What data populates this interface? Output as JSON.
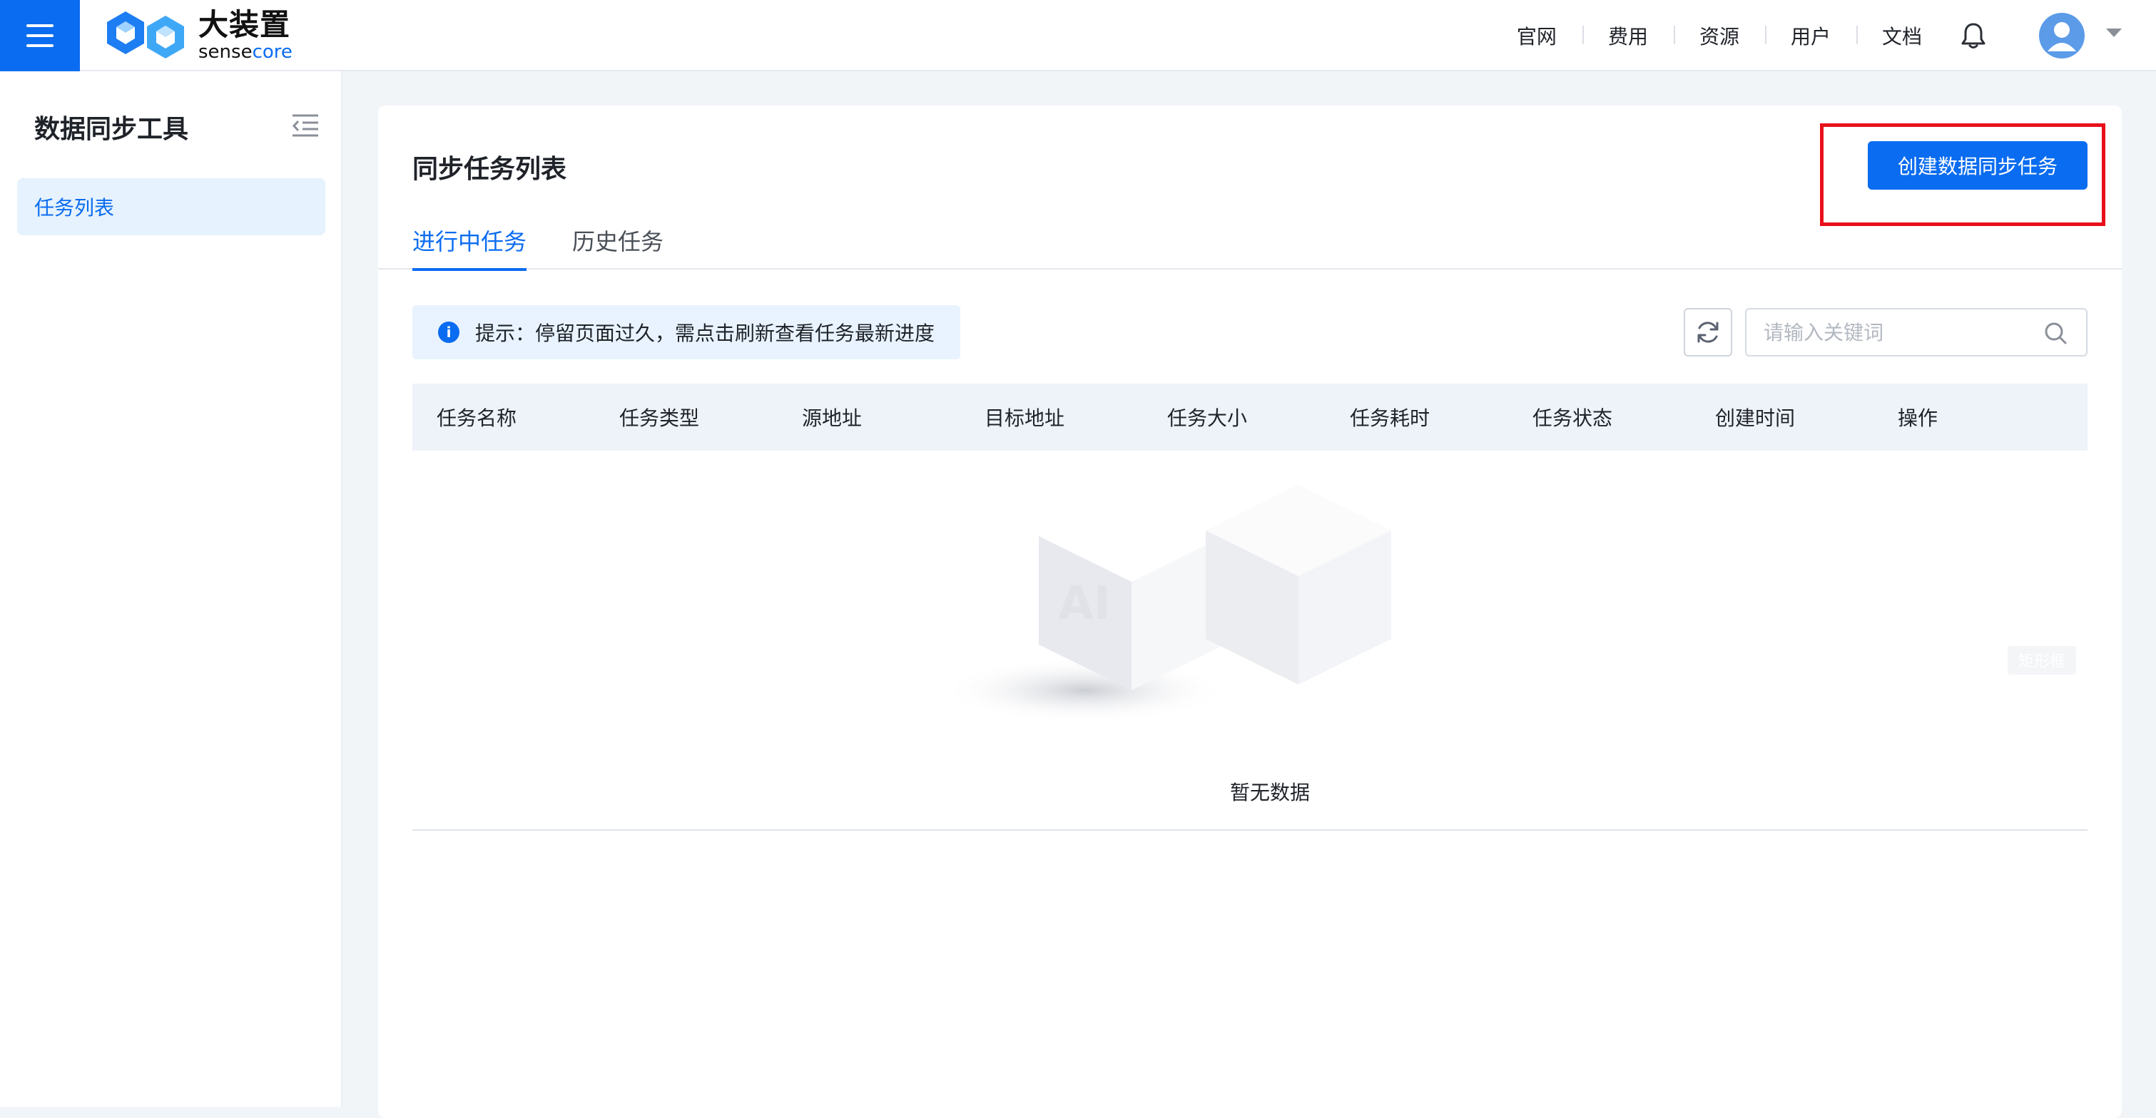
{
  "header": {
    "logo_cn": "大装置",
    "logo_en_part1": "sense",
    "logo_en_part2": "core",
    "nav": [
      "官网",
      "费用",
      "资源",
      "用户",
      "文档"
    ]
  },
  "sidebar": {
    "title": "数据同步工具",
    "items": [
      {
        "label": "任务列表",
        "active": true
      }
    ]
  },
  "main": {
    "title": "同步任务列表",
    "create_button": "创建数据同步任务",
    "tabs": [
      {
        "label": "进行中任务",
        "active": true
      },
      {
        "label": "历史任务",
        "active": false
      }
    ],
    "tip": "提示：停留页面过久，需点击刷新查看任务最新进度",
    "search": {
      "placeholder": "请输入关键词",
      "value": ""
    },
    "table": {
      "columns": [
        "任务名称",
        "任务类型",
        "源地址",
        "目标地址",
        "任务大小",
        "任务耗时",
        "任务状态",
        "创建时间",
        "操作"
      ],
      "rows": []
    },
    "empty": {
      "illustration_text": "AI",
      "text": "暂无数据"
    },
    "ghost_badge": "矩形框"
  },
  "colors": {
    "primary": "#0a6cf0",
    "highlight": "#e8101a",
    "tip_bg": "#e8f3ff",
    "table_header_bg": "#eef3f9"
  }
}
